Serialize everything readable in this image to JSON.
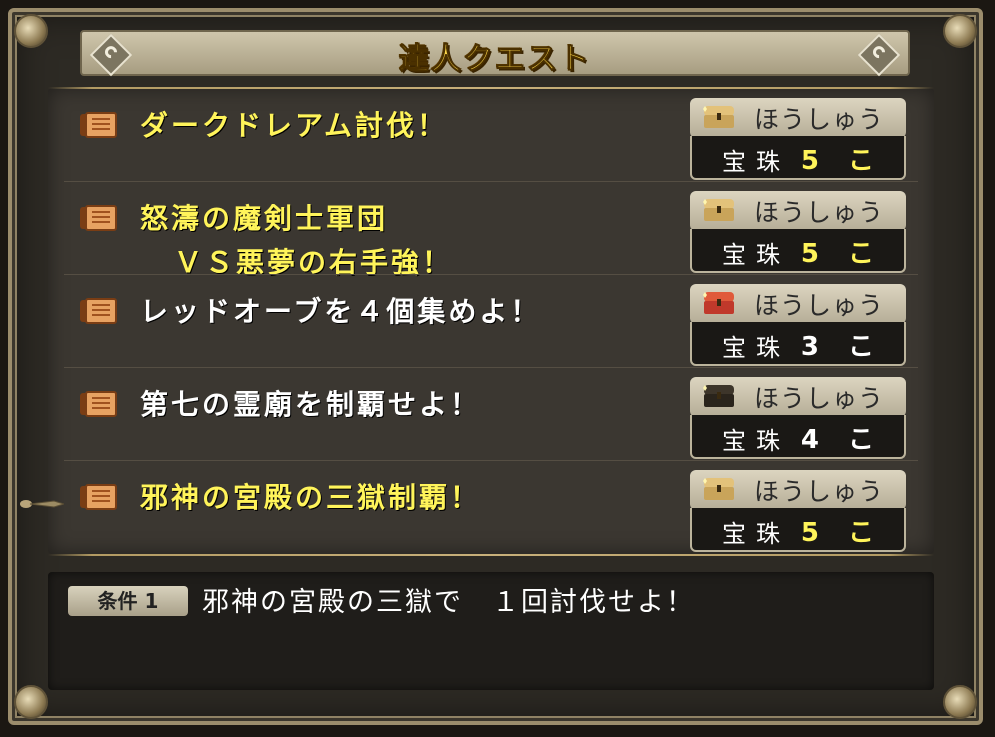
{
  "title": "達人クエスト",
  "colors": {
    "highlight_text": "#fff45a",
    "normal_text": "#ffffff",
    "title_text": "#ffd94a"
  },
  "quests": [
    {
      "name_line1": "ダークドレアム討伐！",
      "name_line2": "",
      "highlighted": true,
      "reward": {
        "label": "ほうしゅう",
        "chest": "gold-chest-icon",
        "item": "宝珠",
        "qty": "5 こ"
      }
    },
    {
      "name_line1": "怒濤の魔剣士軍団",
      "name_line2": "ＶＳ悪夢の右手強！",
      "highlighted": true,
      "reward": {
        "label": "ほうしゅう",
        "chest": "gold-chest-icon",
        "item": "宝珠",
        "qty": "5 こ"
      }
    },
    {
      "name_line1": "レッドオーブを４個集めよ！",
      "name_line2": "",
      "highlighted": false,
      "reward": {
        "label": "ほうしゅう",
        "chest": "red-chest-icon",
        "item": "宝珠",
        "qty": "3 こ"
      }
    },
    {
      "name_line1": "第七の霊廟を制覇せよ！",
      "name_line2": "",
      "highlighted": false,
      "reward": {
        "label": "ほうしゅう",
        "chest": "black-chest-icon",
        "item": "宝珠",
        "qty": "4 こ"
      }
    },
    {
      "name_line1": "邪神の宮殿の三獄制覇！",
      "name_line2": "",
      "highlighted": true,
      "selected": true,
      "reward": {
        "label": "ほうしゅう",
        "chest": "gold-chest-icon",
        "item": "宝珠",
        "qty": "5 こ"
      }
    }
  ],
  "condition": {
    "badge": "条件 1",
    "text": "邪神の宮殿の三獄で　１回討伐せよ！"
  }
}
